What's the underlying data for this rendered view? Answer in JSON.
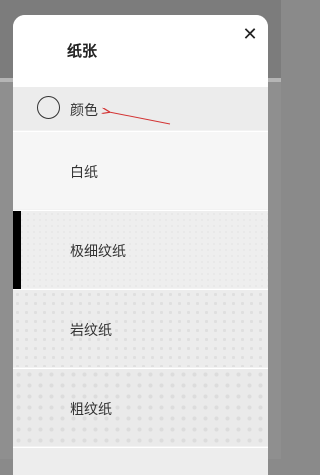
{
  "panel": {
    "title": "纸张",
    "close_glyph": "✕"
  },
  "rows": [
    {
      "label": "颜色"
    },
    {
      "label": "白纸"
    },
    {
      "label": "极细纹纸",
      "selected": true
    },
    {
      "label": "岩纹纸"
    },
    {
      "label": "粗纹纸"
    }
  ],
  "colors": {
    "arrow": "#d33333",
    "selected_marker": "#000000"
  }
}
